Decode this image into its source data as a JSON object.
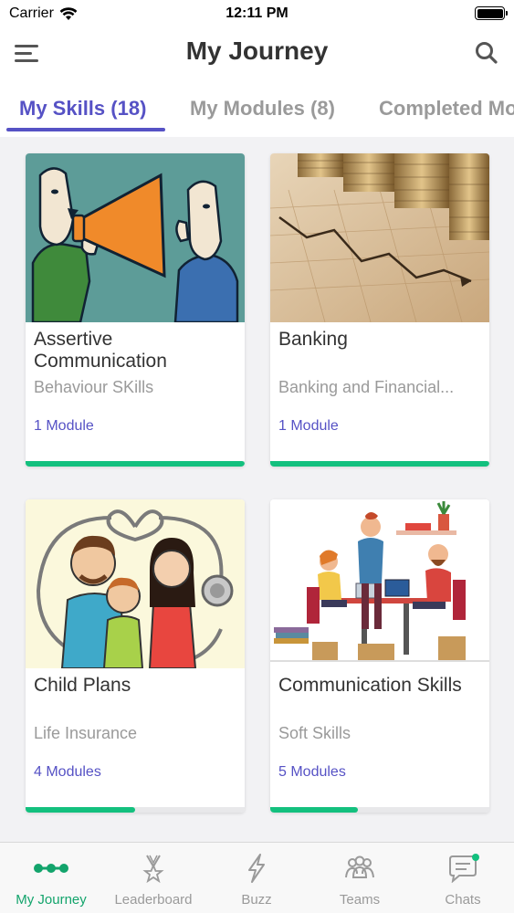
{
  "status_bar": {
    "carrier": "Carrier",
    "time": "12:11 PM"
  },
  "nav": {
    "title": "My Journey"
  },
  "tabs": [
    {
      "label": "My Skills (18)",
      "active": true
    },
    {
      "label": "My Modules (8)",
      "active": false
    },
    {
      "label": "Completed Mo",
      "active": false
    }
  ],
  "cards": [
    {
      "title": "Assertive Communication",
      "subtitle": "Behaviour SKills",
      "modules": "1 Module",
      "progress": 1.0,
      "image": "megaphone-illustration"
    },
    {
      "title": "Banking",
      "subtitle": "Banking and Financial...",
      "modules": "1 Module",
      "progress": 1.0,
      "image": "coins-chart-photo"
    },
    {
      "title": "Child Plans",
      "subtitle": "Life Insurance",
      "modules": "4 Modules",
      "progress": 0.5,
      "image": "family-stethoscope-illustration"
    },
    {
      "title": "Communication Skills",
      "subtitle": "Soft Skills",
      "modules": "5 Modules",
      "progress": 0.4,
      "image": "office-team-illustration"
    }
  ],
  "tab_bar": [
    {
      "label": "My Journey",
      "icon": "journey-icon",
      "active": true
    },
    {
      "label": "Leaderboard",
      "icon": "medal-icon",
      "active": false
    },
    {
      "label": "Buzz",
      "icon": "lightning-icon",
      "active": false
    },
    {
      "label": "Teams",
      "icon": "people-icon",
      "active": false
    },
    {
      "label": "Chats",
      "icon": "chat-icon",
      "active": false,
      "badge": true
    }
  ],
  "colors": {
    "accent": "#5652c5",
    "success": "#13c07e",
    "active_tab": "#13a46c"
  }
}
